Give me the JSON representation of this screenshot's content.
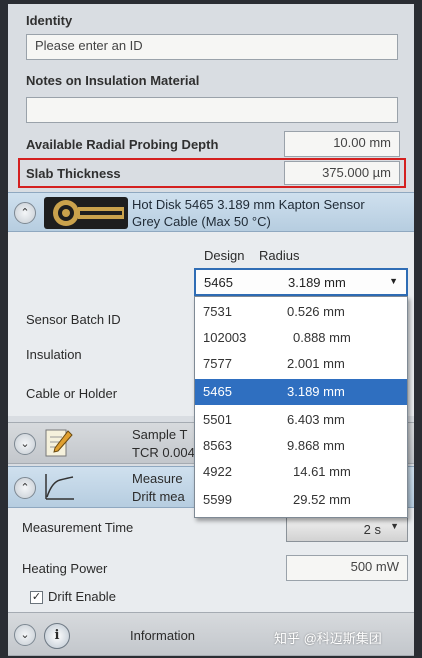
{
  "identity": {
    "label": "Identity",
    "placeholder": "Please enter an ID"
  },
  "notes": {
    "label": "Notes on Insulation Material",
    "value": ""
  },
  "radial_depth": {
    "label": "Available Radial Probing Depth",
    "value": "10.00 mm"
  },
  "slab": {
    "label": "Slab Thickness",
    "value": "375.000 µm"
  },
  "sensor": {
    "title_line1": "Hot Disk 5465   3.189 mm Kapton Sensor",
    "title_line2": "Grey Cable (Max 50 °C)",
    "col_design": "Design",
    "col_radius": "Radius",
    "selected_design": "5465",
    "selected_radius": "3.189 mm",
    "batch_label": "Sensor Batch ID",
    "insulation_label": "Insulation",
    "cable_label": "Cable or Holder",
    "options": [
      {
        "design": "7531",
        "radius": "0.526 mm"
      },
      {
        "design": "102003",
        "radius": "0.888 mm"
      },
      {
        "design": "7577",
        "radius": "2.001 mm"
      },
      {
        "design": "5465",
        "radius": "3.189 mm",
        "selected": true
      },
      {
        "design": "5501",
        "radius": "6.403 mm"
      },
      {
        "design": "8563",
        "radius": "9.868 mm"
      },
      {
        "design": "4922",
        "radius": "14.61 mm"
      },
      {
        "design": "5599",
        "radius": "29.52 mm"
      }
    ]
  },
  "sample": {
    "line1": "Sample T",
    "line2": "TCR 0.004"
  },
  "measure": {
    "line1": "Measure",
    "line2": "Drift mea",
    "time_label": "Measurement Time",
    "time_value": "2 s",
    "power_label": "Heating Power",
    "power_value": "500 mW",
    "drift_label": "Drift Enable",
    "drift_checked": true
  },
  "information": {
    "label": "Information"
  },
  "watermark": "知乎 @科迈斯集团",
  "colors": {
    "highlight": "#d4201f",
    "selection": "#2f6fc0"
  }
}
